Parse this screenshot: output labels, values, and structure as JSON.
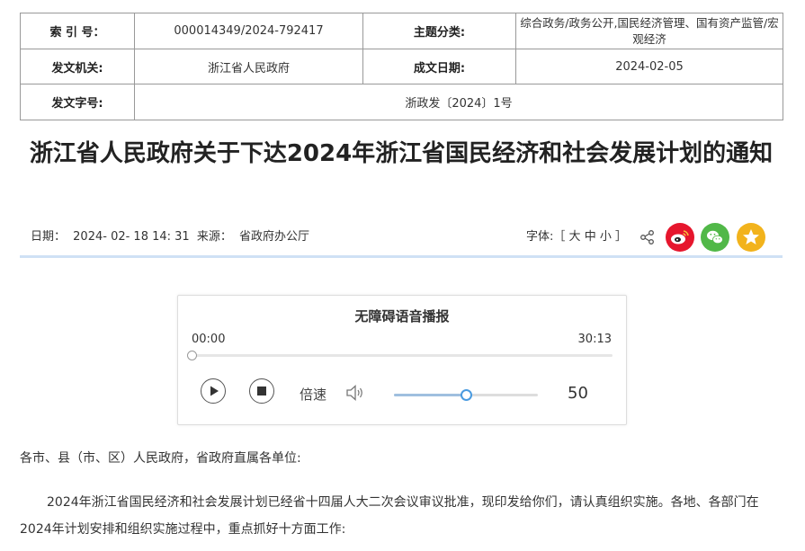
{
  "meta": {
    "index_label": "索 引 号：",
    "index_value": "000014349/2024-792417",
    "topic_label": "主题分类:",
    "topic_value": "综合政务/政务公开,国民经济管理、国有资产监管/宏观经济",
    "issuer_label": "发文机关:",
    "issuer_value": "浙江省人民政府",
    "date_label": "成文日期:",
    "date_value": "2024-02-05",
    "doc_no_label": "发文字号:",
    "doc_no_value": "浙政发〔2024〕1号"
  },
  "article": {
    "title": "浙江省人民政府关于下达2024年浙江省国民经济和社会发展计划的通知",
    "date_label": "日期：",
    "date": "2024- 02- 18 14: 31",
    "source_label": "来源：",
    "source": "省政府办公厅",
    "font_label": "字体:［",
    "font_large": "大",
    "font_medium": "中",
    "font_small": "小",
    "font_close": "］"
  },
  "share": {
    "icons": [
      "share-icon",
      "weibo-icon",
      "wechat-icon",
      "favorite-icon"
    ],
    "colors": {
      "weibo": "#e6162d",
      "wechat": "#51b848",
      "favorite": "#f2b31c"
    }
  },
  "player": {
    "title": "无障碍语音播报",
    "current_time": "00:00",
    "total_time": "30:13",
    "progress": 0,
    "speed_label": "倍速",
    "volume": "50",
    "volume_fraction": 0.5
  },
  "body": {
    "salutation": "各市、县（市、区）人民政府，省政府直属各单位:",
    "paragraph1": "2024年浙江省国民经济和社会发展计划已经省十四届人大二次会议审议批准，现印发给你们，请认真组织实施。各地、各部门在2024年计划安排和组织实施过程中，重点抓好十方面工作:"
  }
}
